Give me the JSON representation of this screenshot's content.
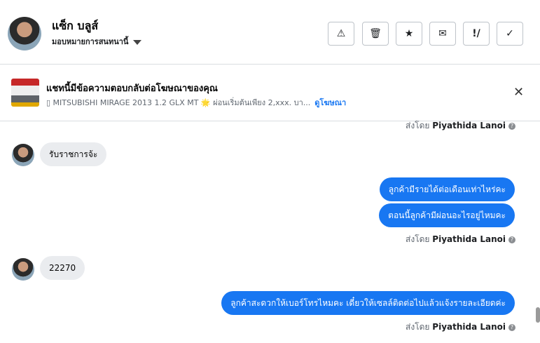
{
  "contact": {
    "name": "แซ็ก บลูส์",
    "assign_label": "มอบหมายการสนทนานี้"
  },
  "toolbar": [
    {
      "name": "spam-button",
      "glyph": "⚠"
    },
    {
      "name": "delete-button",
      "glyph": "🗑"
    },
    {
      "name": "star-button",
      "glyph": "★"
    },
    {
      "name": "mark-unread-button",
      "glyph": "✉"
    },
    {
      "name": "follow-up-button",
      "glyph": "!/"
    },
    {
      "name": "mark-done-button",
      "glyph": "✓"
    }
  ],
  "ad": {
    "title": "แชทนี้มีข้อความตอบกลับต่อโฆษณาของคุณ",
    "subtitle": "▯ MITSUBISHI MIRAGE 2013 1.2 GLX MT 🌟 ผ่อนเริ่มต้นเพียง 2,xxx. บา...",
    "link_label": "ดูโฆษณา",
    "close_glyph": "✕"
  },
  "sent_by": {
    "prefix": "ส่งโดย",
    "name": "Piyathida Lanoi",
    "info_glyph": "?"
  },
  "messages": {
    "m1": "รับราชการจ้ะ",
    "m2": "ลูกค้ามีรายได้ต่อเดือนเท่าไหร่คะ",
    "m3": "ตอนนี้ลูกค้ามีผ่อนอะไรอยู่ไหมคะ",
    "m4": "22270",
    "m5": "ลูกค้าสะดวกให้เบอร์โทรไหมคะ เดี๋ยวให้เซลล์ติดต่อไปแล้วแจ้งรายละเอียดค่ะ"
  },
  "colors": {
    "accent": "#1877f2",
    "incoming_bubble": "#eaecef"
  }
}
